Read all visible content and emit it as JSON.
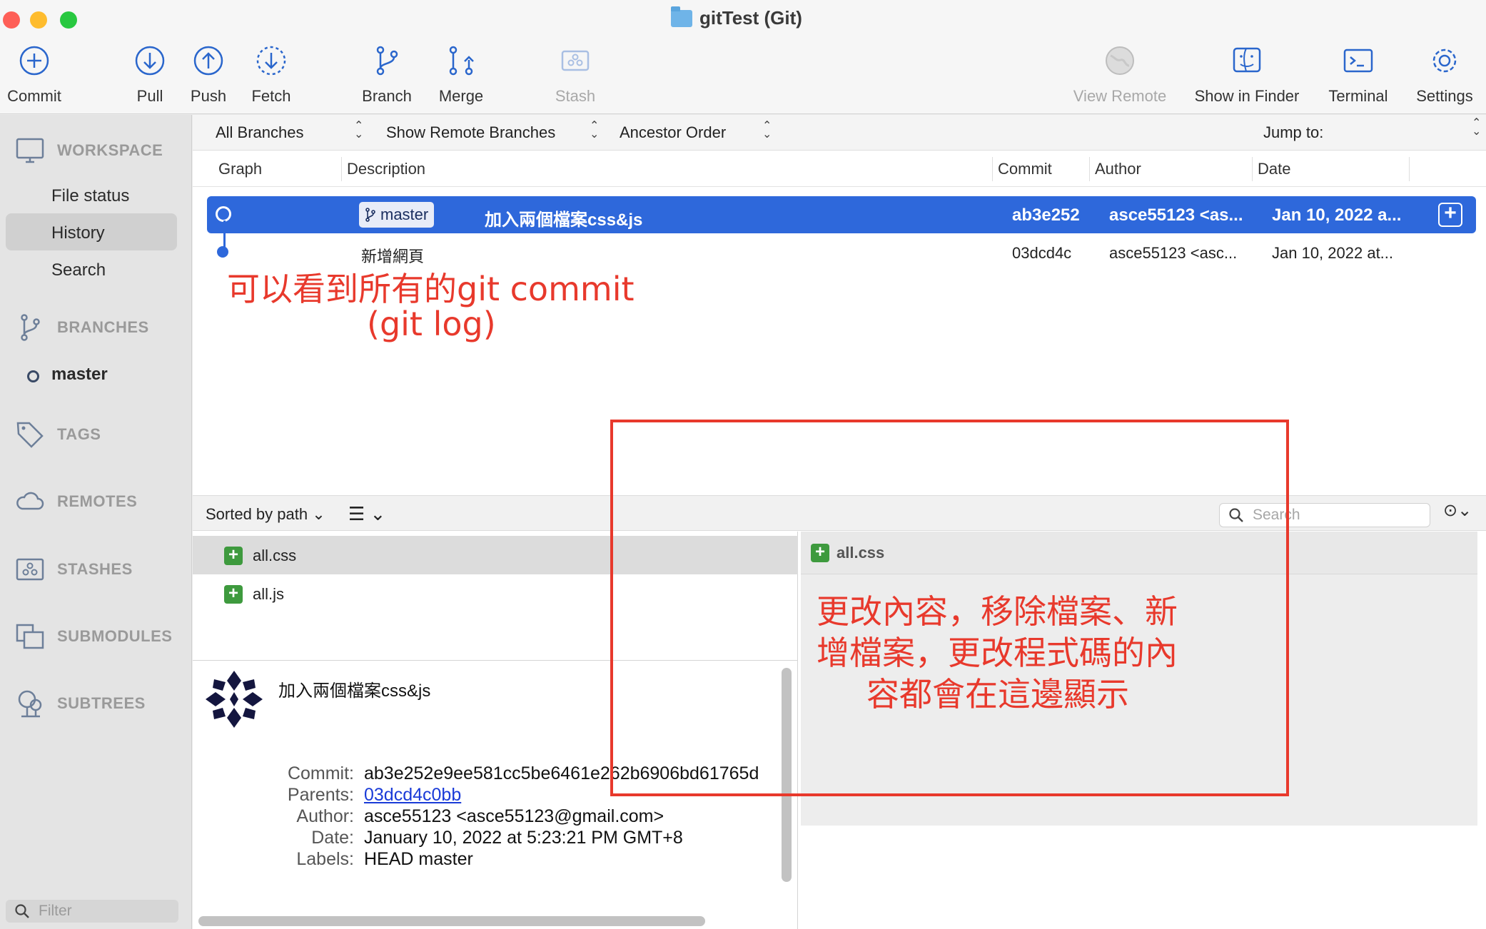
{
  "window": {
    "title": "gitTest (Git)"
  },
  "toolbar": {
    "commit": "Commit",
    "pull": "Pull",
    "push": "Push",
    "fetch": "Fetch",
    "branch": "Branch",
    "merge": "Merge",
    "stash": "Stash",
    "view_remote": "View Remote",
    "show_in_finder": "Show in Finder",
    "terminal": "Terminal",
    "settings": "Settings"
  },
  "sidebar": {
    "workspace": "WORKSPACE",
    "file_status": "File status",
    "history": "History",
    "search": "Search",
    "branches": "BRANCHES",
    "current_branch": "master",
    "tags": "TAGS",
    "remotes": "REMOTES",
    "stashes": "STASHES",
    "submodules": "SUBMODULES",
    "subtrees": "SUBTREES",
    "filter_placeholder": "Filter"
  },
  "filterbar": {
    "branches": "All Branches",
    "remote": "Show Remote Branches",
    "order": "Ancestor Order",
    "jump_to": "Jump to:"
  },
  "columns": {
    "graph": "Graph",
    "description": "Description",
    "commit": "Commit",
    "author": "Author",
    "date": "Date"
  },
  "commits": [
    {
      "branch_tag": "master",
      "description": "加入兩個檔案css&js",
      "hash": "ab3e252",
      "author": "asce55123 <as...",
      "date": "Jan 10, 2022 a..."
    },
    {
      "description": "新增網頁",
      "hash": "03dcd4c",
      "author": "asce55123 <asc...",
      "date": "Jan 10, 2022 at..."
    }
  ],
  "annotations": {
    "log_line1": "可以看到所有的git commit",
    "log_line2": "(git log)",
    "diff_line1": "更改內容，移除檔案、新",
    "diff_line2": "增檔案，更改程式碼的內",
    "diff_line3": "容都會在這邊顯示"
  },
  "lower": {
    "sorted": "Sorted by path",
    "search_placeholder": "Search",
    "files": [
      "all.css",
      "all.js"
    ],
    "diff_file": "all.css"
  },
  "details": {
    "message": "加入兩個檔案css&js",
    "commit_label": "Commit:",
    "commit_value": "ab3e252e9ee581cc5be6461e262b6906bd61765d",
    "parents_label": "Parents:",
    "parents_value": "03dcd4c0bb",
    "author_label": "Author:",
    "author_value": "asce55123 <asce55123@gmail.com>",
    "date_label": "Date:",
    "date_value": "January 10, 2022 at 5:23:21 PM GMT+8",
    "labels_label": "Labels:",
    "labels_value": "HEAD master"
  },
  "colors": {
    "selection": "#2e68db",
    "annotation": "#e8392c",
    "added": "#3e9a3e"
  }
}
